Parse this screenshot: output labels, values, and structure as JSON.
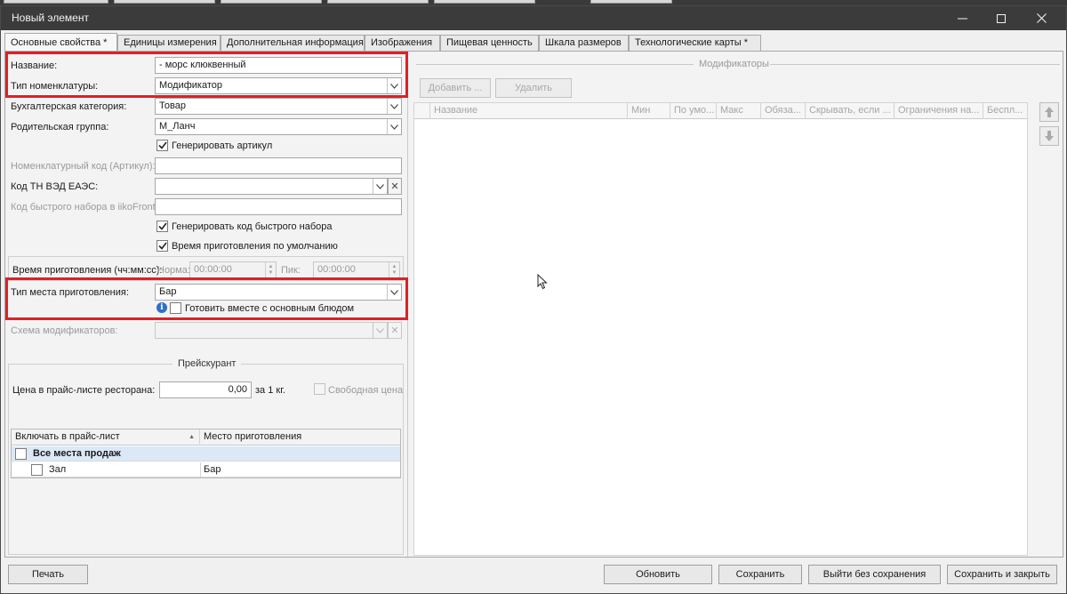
{
  "window": {
    "title": "Новый элемент",
    "minimize_icon": "minimize-icon",
    "maximize_icon": "maximize-icon",
    "close_icon": "close-icon"
  },
  "tabs": [
    {
      "label": "Основные свойства *",
      "active": true
    },
    {
      "label": "Единицы измерения"
    },
    {
      "label": "Дополнительная информация"
    },
    {
      "label": "Изображения"
    },
    {
      "label": "Пищевая ценность"
    },
    {
      "label": "Шкала размеров"
    },
    {
      "label": "Технологические карты *"
    }
  ],
  "form": {
    "name_label": "Название:",
    "name_value": "- морс клюквенный",
    "nomenclature_type_label": "Тип номенклатуры:",
    "nomenclature_type_value": "Модификатор",
    "accounting_category_label": "Бухгалтерская категория:",
    "accounting_category_value": "Товар",
    "parent_group_label": "Родительская группа:",
    "parent_group_value": "М_Ланч",
    "generate_article_label": "Генерировать артикул",
    "generate_article_checked": true,
    "nomenclature_code_label": "Номенклатурный код (Артикул):",
    "nomenclature_code_value": "",
    "tnved_label": "Код ТН ВЭД ЕАЭС:",
    "tnved_value": "",
    "tnved_clear": "✕",
    "quick_code_label": "Код быстрого набора в iikoFront:",
    "quick_code_value": "",
    "generate_quick_code_label": "Генерировать код быстрого набора",
    "generate_quick_code_checked": true,
    "default_cook_time_label": "Время приготовления по умолчанию",
    "default_cook_time_checked": true,
    "cook_time_label": "Время приготовления (чч:мм:сс):",
    "norm_label": "Норма:",
    "norm_value": "00:00:00",
    "peak_label": "Пик:",
    "peak_value": "00:00:00",
    "cook_place_type_label": "Тип места приготовления:",
    "cook_place_type_value": "Бар",
    "cook_with_main_label": "Готовить вместе с основным блюдом",
    "cook_with_main_checked": false,
    "info_glyph": "i",
    "modifier_scheme_label": "Схема модификаторов:",
    "modifier_scheme_value": ""
  },
  "pricelist": {
    "title": "Прейскурант",
    "price_label": "Цена в прайс-листе ресторана:",
    "price_value": "0,00",
    "price_unit": "за 1 кг.",
    "free_price_label": "Свободная цена",
    "free_price_checked": false,
    "columns": [
      "Включать в прайс-лист",
      "Место приготовления"
    ],
    "sort_glyph": "▲",
    "group_row": "Все места продаж",
    "rows": [
      {
        "name": "Зал",
        "place": "Бар",
        "checked": false
      }
    ]
  },
  "modifiers": {
    "title": "Модификаторы",
    "add_button": "Добавить ...",
    "delete_button": "Удалить",
    "columns": [
      "Название",
      "Мин",
      "По умо...",
      "Макс",
      "Обяза...",
      "Скрывать, если ...",
      "Ограничения на...",
      "Беспл..."
    ],
    "up_icon": "arrow-up-icon",
    "down_icon": "arrow-down-icon"
  },
  "footer": {
    "print_button": "Печать",
    "refresh_button": "Обновить",
    "save_button": "Сохранить",
    "exit_no_save_button": "Выйти без сохранения",
    "save_close_button": "Сохранить и закрыть"
  },
  "colors": {
    "titlebar": "#3b3b3b",
    "highlight_box": "#e41e26",
    "info_icon": "#2f6fc9"
  }
}
